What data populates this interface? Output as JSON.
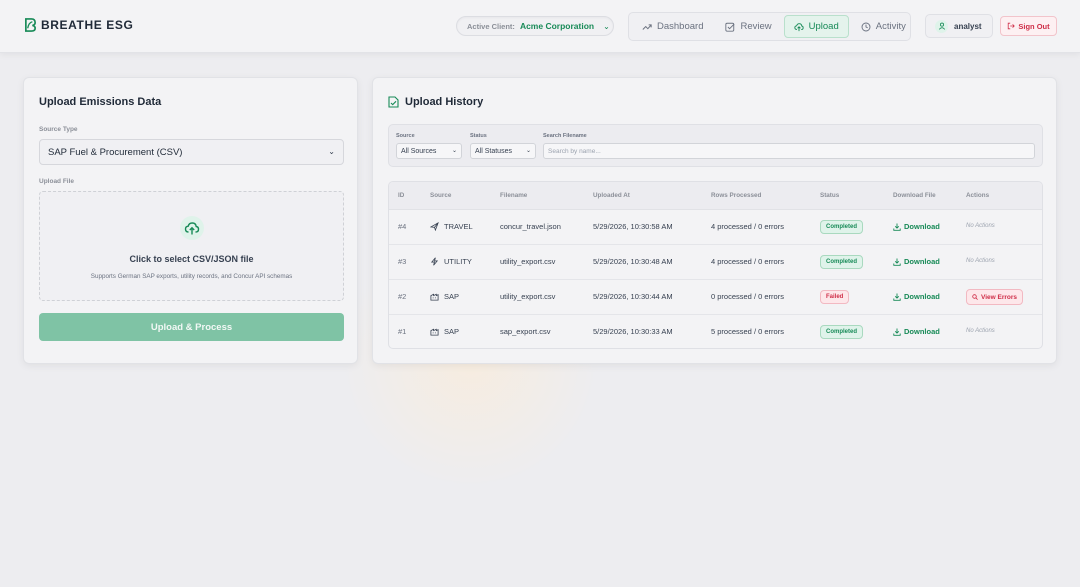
{
  "app": {
    "brand": "BREATHE ESG"
  },
  "client": {
    "label": "Active Client:",
    "value": "Acme Corporation"
  },
  "nav": {
    "items": [
      {
        "label": "Dashboard",
        "icon": "trending-up-icon"
      },
      {
        "label": "Review",
        "icon": "check-square-icon"
      },
      {
        "label": "Upload",
        "icon": "cloud-upload-icon",
        "active": true
      },
      {
        "label": "Activity",
        "icon": "clock-icon"
      }
    ]
  },
  "user": {
    "name": "analyst",
    "signout": "Sign Out"
  },
  "upload": {
    "title": "Upload Emissions Data",
    "source_type_label": "Source Type",
    "source_type_value": "SAP Fuel & Procurement (CSV)",
    "file_label": "Upload File",
    "dropzone_title": "Click to select CSV/JSON file",
    "dropzone_sub": "Supports German SAP exports, utility records, and Concur API schemas",
    "button": "Upload & Process"
  },
  "history": {
    "title": "Upload History",
    "filters": {
      "source_label": "Source",
      "source_value": "All Sources",
      "status_label": "Status",
      "status_value": "All Statuses",
      "search_label": "Search Filename",
      "search_placeholder": "Search by name..."
    },
    "columns": [
      "ID",
      "Source",
      "Filename",
      "Uploaded At",
      "Rows Processed",
      "Status",
      "Download File",
      "Actions"
    ],
    "rows": [
      {
        "id": "#4",
        "source": "TRAVEL",
        "source_icon": "plane-icon",
        "filename": "concur_travel.json",
        "uploaded": "5/29/2026, 10:30:58 AM",
        "rows": "4 processed / 0 errors",
        "status": "Completed",
        "download": "Download",
        "action": "No Actions"
      },
      {
        "id": "#3",
        "source": "UTILITY",
        "source_icon": "zap-icon",
        "filename": "utility_export.csv",
        "uploaded": "5/29/2026, 10:30:48 AM",
        "rows": "4 processed / 0 errors",
        "status": "Completed",
        "download": "Download",
        "action": "No Actions"
      },
      {
        "id": "#2",
        "source": "SAP",
        "source_icon": "factory-icon",
        "filename": "utility_export.csv",
        "uploaded": "5/29/2026, 10:30:44 AM",
        "rows": "0 processed / 0 errors",
        "status": "Failed",
        "download": "Download",
        "action": "View Errors"
      },
      {
        "id": "#1",
        "source": "SAP",
        "source_icon": "factory-icon",
        "filename": "sap_export.csv",
        "uploaded": "5/29/2026, 10:30:33 AM",
        "rows": "5 processed / 0 errors",
        "status": "Completed",
        "download": "Download",
        "action": "No Actions"
      }
    ]
  },
  "colors": {
    "accent": "#178a57",
    "danger": "#cf2e48",
    "background": "#ededf0"
  }
}
